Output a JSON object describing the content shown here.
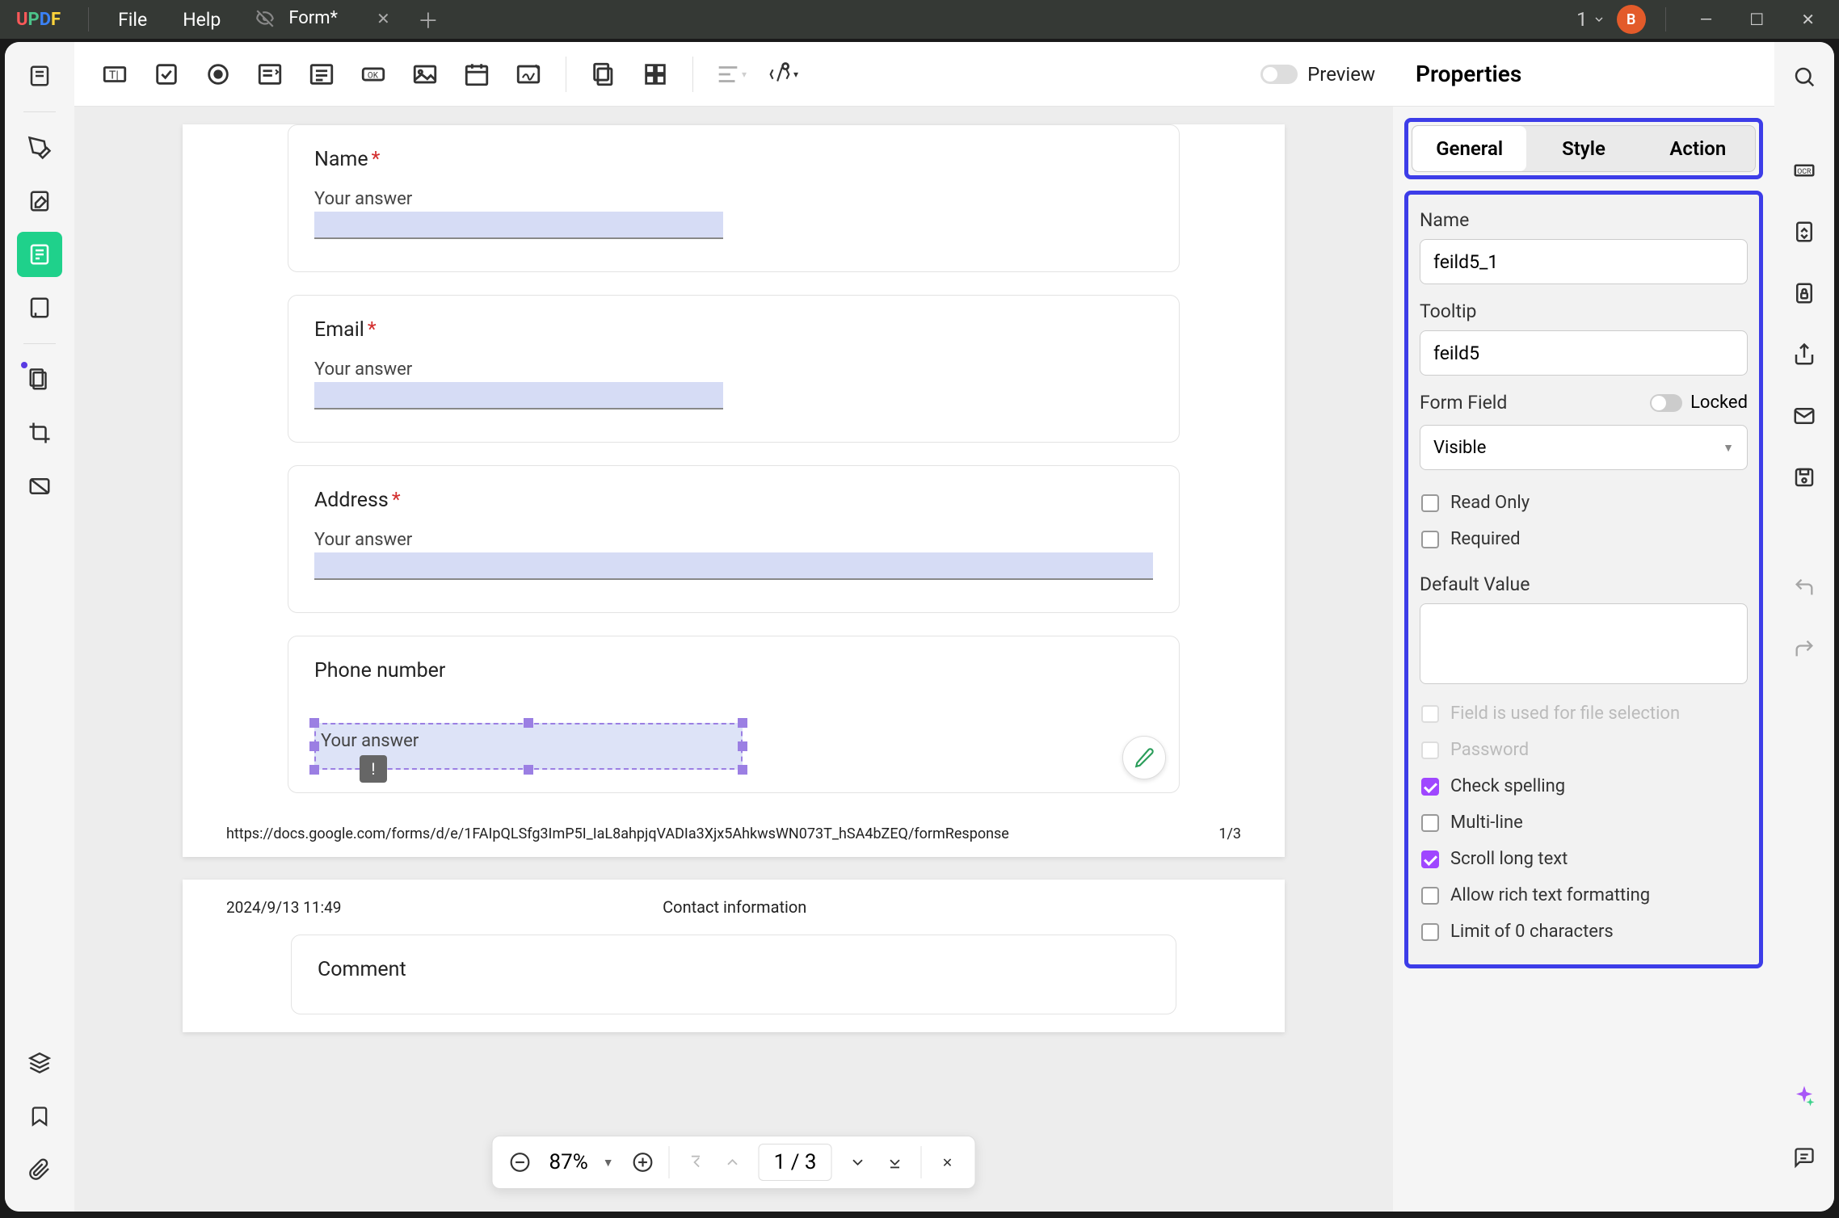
{
  "titlebar": {
    "menu_file": "File",
    "menu_help": "Help",
    "tab_title": "Form*",
    "window_count": "1",
    "avatar_letter": "B"
  },
  "toolbar": {
    "preview_label": "Preview"
  },
  "form": {
    "name_label": "Name",
    "name_placeholder": "Your answer",
    "email_label": "Email",
    "email_placeholder": "Your answer",
    "address_label": "Address",
    "address_placeholder": "Your answer",
    "phone_label": "Phone number",
    "phone_placeholder": "Your answer",
    "url": "https://docs.google.com/forms/d/e/1FAIpQLSfg3ImP5I_IaL8ahpjqVADIa3Xjx5AhkwsWN073T_hSA4bZEQ/formResponse",
    "page_indicator": "1/3",
    "timestamp": "2024/9/13 11:49",
    "section": "Contact information",
    "comment_label": "Comment"
  },
  "zoom": {
    "level": "87%",
    "page": "1 / 3"
  },
  "properties": {
    "title": "Properties",
    "tabs": {
      "general": "General",
      "style": "Style",
      "action": "Action"
    },
    "name_label": "Name",
    "name_value": "feild5_1",
    "tooltip_label": "Tooltip",
    "tooltip_value": "feild5",
    "form_field_label": "Form Field",
    "locked_label": "Locked",
    "visibility": "Visible",
    "read_only": "Read Only",
    "required": "Required",
    "default_value_label": "Default Value",
    "file_selection": "Field is used for file selection",
    "password": "Password",
    "check_spelling": "Check spelling",
    "multi_line": "Multi-line",
    "scroll_long": "Scroll long text",
    "rich_text": "Allow rich text formatting",
    "limit_chars": "Limit of 0 characters"
  }
}
